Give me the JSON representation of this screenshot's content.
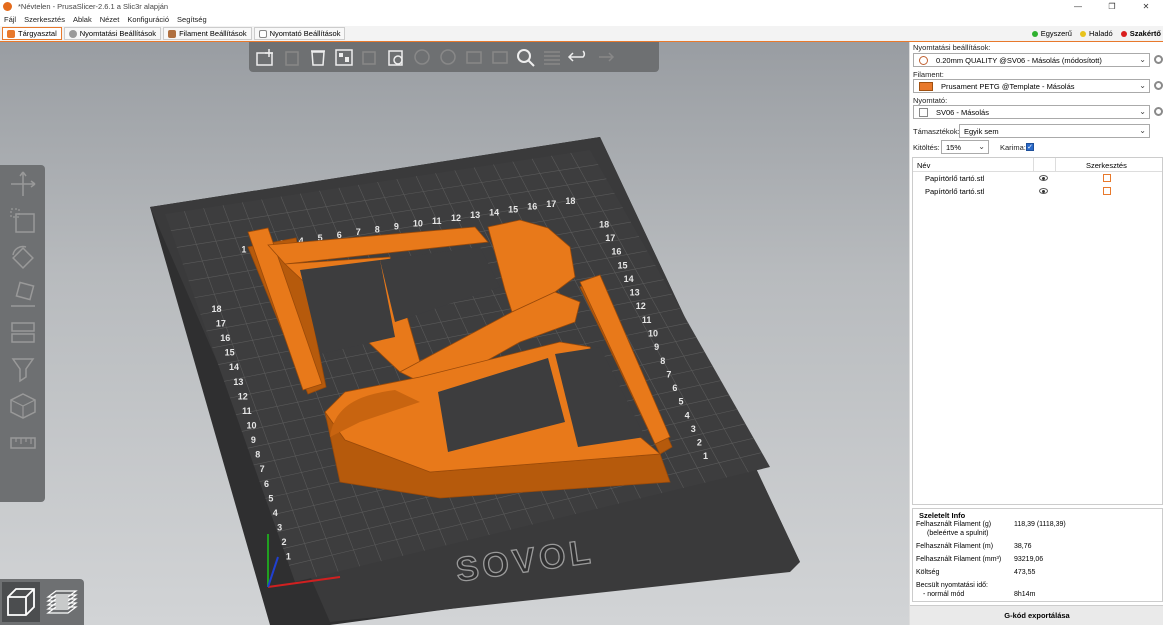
{
  "window": {
    "title": "*Névtelen - PrusaSlicer-2.6.1 a Slic3r alapján",
    "controls": [
      "—",
      "❐",
      "✕"
    ]
  },
  "menu": [
    "Fájl",
    "Szerkesztés",
    "Ablak",
    "Nézet",
    "Konfiguráció",
    "Segítség"
  ],
  "tabs": [
    {
      "label": "Tárgyasztal",
      "active": true,
      "color": "#e8792c"
    },
    {
      "label": "Nyomtatási Beállítások",
      "active": false,
      "color": "#9a9a9a"
    },
    {
      "label": "Filament Beállítások",
      "active": false,
      "color": "#b07040"
    },
    {
      "label": "Nyomtató Beállítások",
      "active": false,
      "color": "#888888"
    }
  ],
  "modes": [
    {
      "label": "Egyszerű",
      "color": "#2fb12f",
      "active": false
    },
    {
      "label": "Haladó",
      "color": "#e8c31c",
      "active": false
    },
    {
      "label": "Szakértő",
      "color": "#d91e1e",
      "active": true
    }
  ],
  "toolbar_top": [
    "add-icon",
    "delete-icon",
    "delete-all-icon",
    "arrange-icon",
    "copy-icon",
    "paste-icon",
    "add-instance-icon",
    "remove-instance-icon",
    "split-objects-icon",
    "split-parts-icon",
    "search-icon",
    "layers-editing-icon",
    "undo-icon",
    "redo-icon"
  ],
  "toolbar_left": [
    "move-icon",
    "scale-icon",
    "rotate-icon",
    "place-on-face-icon",
    "cut-icon",
    "paint-supports-icon",
    "seam-painting-icon",
    "measure-icon"
  ],
  "view_switch": [
    "3d-view-icon",
    "preview-icon"
  ],
  "bed": {
    "brand": "SOVOL",
    "tick_labels": [
      "1",
      "2",
      "3",
      "4",
      "5",
      "6",
      "7",
      "8",
      "9",
      "10",
      "11",
      "12",
      "13",
      "14",
      "15",
      "16",
      "17",
      "18"
    ]
  },
  "panel": {
    "print_settings_label": "Nyomtatási beállítások:",
    "print_settings_value": "0.20mm QUALITY @SV06 - Másolás (módosított)",
    "filament_label": "Filament:",
    "filament_value": "Prusament PETG @Template - Másolás",
    "filament_color": "#e8792c",
    "printer_label": "Nyomtató:",
    "printer_value": "SV06 - Másolás",
    "supports_label": "Támasztékok:",
    "supports_value": "Egyik sem",
    "infill_label": "Kitöltés:",
    "infill_value": "15%",
    "brim_label": "Karima:",
    "brim_checked": true,
    "object_list": {
      "col_name": "Név",
      "col_edit": "Szerkesztés",
      "rows": [
        "Papírtörlő tartó.stl",
        "Papírtörlő tartó.stl"
      ]
    },
    "sliced_info": {
      "title": "Szeletelt Info",
      "rows": [
        {
          "k": "Felhasznált Filament (g)",
          "v": "118,39 (1118,39)"
        },
        {
          "k": "(beleértve a spulnit)",
          "v": ""
        },
        {
          "k": "Felhasznált Filament (m)",
          "v": "38,76"
        },
        {
          "k": "Felhasznált Filament (mm³)",
          "v": "93219,06"
        },
        {
          "k": "Költség",
          "v": "473,55"
        },
        {
          "k": "Becsült nyomtatási idő:",
          "v": ""
        },
        {
          "k": "- normál mód",
          "v": "8h14m"
        }
      ]
    },
    "export_label": "G-kód exportálása"
  }
}
